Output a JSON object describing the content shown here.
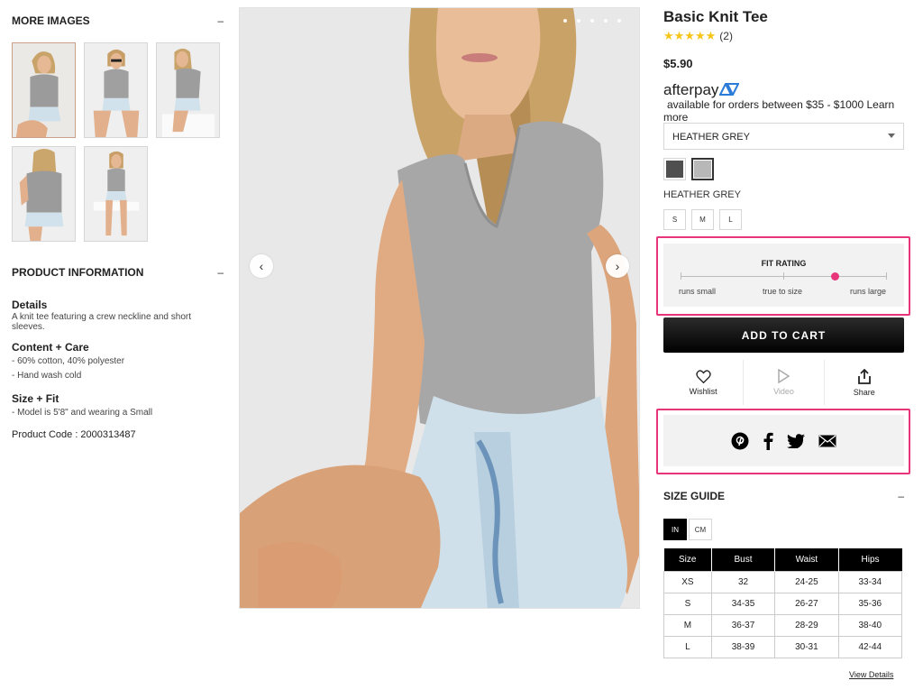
{
  "left": {
    "more_images_title": "MORE IMAGES",
    "more_images_toggle": "–",
    "product_info_title": "PRODUCT INFORMATION",
    "product_info_toggle": "–",
    "details_title": "Details",
    "details_text": "A knit tee featuring a crew neckline and short sleeves.",
    "content_title": "Content + Care",
    "content_items": [
      "- 60% cotton, 40% polyester",
      "- Hand wash cold"
    ],
    "sizefit_title": "Size + Fit",
    "sizefit_items": [
      "- Model is 5'8\" and wearing a Small"
    ],
    "product_code": "Product Code : 2000313487"
  },
  "gallery": {
    "prev_icon": "chevron-left-icon",
    "next_icon": "chevron-right-icon",
    "prev_glyph": "‹",
    "next_glyph": "›"
  },
  "product": {
    "title": "Basic Knit Tee",
    "stars": "★★★★★",
    "rating": 5,
    "review_count": "(2)",
    "price": "$5.90",
    "afterpay_brand": "afterpay",
    "afterpay_text": "available for orders between $35 - $1000 Learn more",
    "selected_color": "HEATHER GREY",
    "color_label": "HEATHER GREY",
    "swatch_colors": [
      "#4f4f4f",
      "#b8b8b8"
    ],
    "sizes": [
      "S",
      "M",
      "L"
    ]
  },
  "fit": {
    "title": "FIT RATING",
    "left_label": "runs small",
    "mid_label": "true to size",
    "right_label": "runs large",
    "value": 0.75,
    "accent": "#e8357a"
  },
  "actions": {
    "add_to_cart": "ADD TO CART",
    "wishlist": "Wishlist",
    "video": "Video",
    "share": "Share"
  },
  "size_guide": {
    "title": "SIZE GUIDE",
    "toggle": "–",
    "units": [
      "IN",
      "CM"
    ],
    "headers": [
      "Size",
      "Bust",
      "Waist",
      "Hips"
    ],
    "rows": [
      [
        "XS",
        "32",
        "24-25",
        "33-34"
      ],
      [
        "S",
        "34-35",
        "26-27",
        "35-36"
      ],
      [
        "M",
        "36-37",
        "28-29",
        "38-40"
      ],
      [
        "L",
        "38-39",
        "30-31",
        "42-44"
      ]
    ],
    "view_details": "View Details"
  }
}
